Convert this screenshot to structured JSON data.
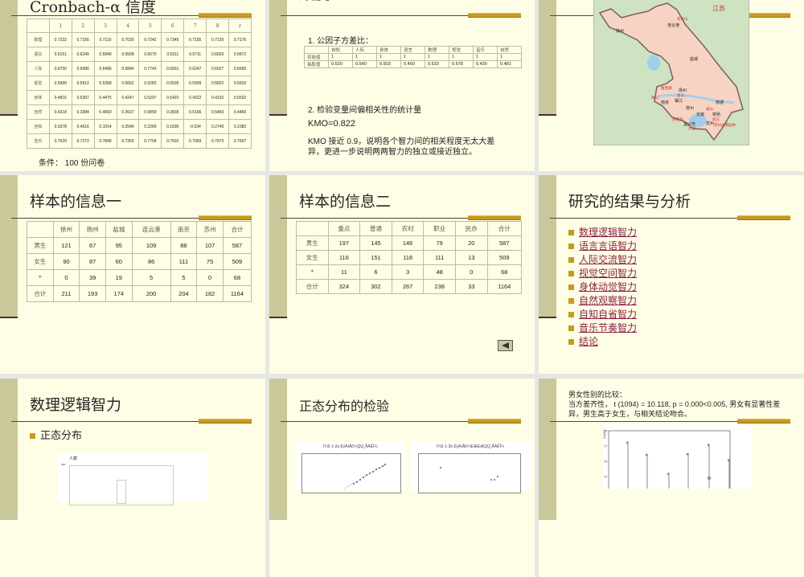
{
  "slide1": {
    "title": "Cronbach-α 信度",
    "footer": "条件： 100 份问卷",
    "table": {
      "headers": [
        "",
        "1",
        "2",
        "3",
        "4",
        "5",
        "6",
        "7",
        "8",
        "r"
      ],
      "rows": [
        [
          "数理",
          "0.7232",
          "0.7156",
          "0.7115",
          "0.7035",
          "0.7242",
          "0.7345",
          "0.7155",
          "0.7130",
          "0.7176"
        ],
        [
          "语言",
          "0.6151",
          "0.6249",
          "0.5949",
          "0.5508",
          "0.6070",
          "0.5311",
          "0.5711",
          "0.6026",
          "0.5872"
        ],
        [
          "人际",
          "0.6750",
          "0.6580",
          "0.6496",
          "0.6846",
          "0.7743",
          "0.6551",
          "0.6247",
          "0.6027",
          "0.6655"
        ],
        [
          "视觉",
          "0.5999",
          "0.5912",
          "0.5358",
          "0.5662",
          "0.6283",
          "0.5535",
          "0.5909",
          "0.5822",
          "0.5810"
        ],
        [
          "身体",
          "0.4816",
          "0.5367",
          "0.4475",
          "0.4247",
          "0.5297",
          "0.5422",
          "0.4322",
          "0.4315",
          "0.5532"
        ],
        [
          "自然",
          "0.4318",
          "0.3384",
          "0.4060",
          "0.3637",
          "0.5859",
          "0.3835",
          "0.5166",
          "0.5460",
          "0.4465"
        ],
        [
          "自知",
          "0.3378",
          "0.4616",
          "0.1014",
          "0.3546",
          "0.2260",
          "0.1830",
          "-0.034",
          "0.2749",
          "0.2382"
        ],
        [
          "音乐",
          "0.7629",
          "0.7272",
          "0.7849",
          "0.7355",
          "0.7704",
          "0.7592",
          "0.7959",
          "0.7973",
          "0.7667"
        ]
      ]
    }
  },
  "slide2": {
    "title": "效度",
    "heading1": "1. 公因子方差比：",
    "table": {
      "headers": [
        "",
        "自知",
        "人际",
        "身体",
        "语言",
        "数理",
        "视觉",
        "音乐",
        "自然"
      ],
      "rows": [
        [
          "初始值",
          "1",
          "1",
          "1",
          "1",
          "1",
          "1",
          "1",
          "1"
        ],
        [
          "抽取值",
          "0.520",
          "0.540",
          "0.503",
          "0.460",
          "0.633",
          "0.578",
          "0.430",
          "0.481"
        ]
      ]
    },
    "heading2": "2. 检验变量间偏相关性的统计量",
    "kmo": "KMO=0.822",
    "para1": "KMO 接近 0.9，说明各个智力间的相关程度无太大差",
    "para2": "异，更进一步说明两两智力的独立或接近独立。"
  },
  "slide3": {
    "map": {
      "province": "江苏",
      "cities": [
        "徐州",
        "连云港",
        "盐城",
        "扬州",
        "南京",
        "镇江",
        "常州",
        "无锡",
        "常熟",
        "南通",
        "苏州",
        "宜兴市"
      ],
      "sights": [
        "花果山",
        "瘦西湖",
        "钟山",
        "金山",
        "虞山",
        "善卷洞",
        "太湖",
        "周庄",
        "苏州古典园林"
      ]
    },
    "colors": {
      "land": "#f7d3c4",
      "sea": "#cfe2c2",
      "water": "#9fd0e8"
    }
  },
  "slide4": {
    "title": "样本的信息一",
    "table": {
      "headers": [
        "",
        "徐州",
        "扬州",
        "盐城",
        "连云港",
        "南京",
        "苏州",
        "合计"
      ],
      "rows": [
        [
          "男生",
          "121",
          "67",
          "95",
          "109",
          "88",
          "107",
          "587"
        ],
        [
          "女生",
          "90",
          "87",
          "60",
          "86",
          "111",
          "75",
          "509"
        ],
        [
          "*",
          "0",
          "39",
          "19",
          "5",
          "5",
          "0",
          "68"
        ],
        [
          "合计",
          "211",
          "193",
          "174",
          "200",
          "204",
          "182",
          "1164"
        ]
      ]
    }
  },
  "slide5": {
    "title": "样本的信息二",
    "table": {
      "headers": [
        "",
        "重点",
        "普通",
        "农村",
        "职业",
        "民办",
        "合计"
      ],
      "rows": [
        [
          "男生",
          "197",
          "145",
          "146",
          "79",
          "20",
          "587"
        ],
        [
          "女生",
          "116",
          "151",
          "118",
          "111",
          "13",
          "509"
        ],
        [
          "*",
          "11",
          "6",
          "3",
          "48",
          "0",
          "68"
        ],
        [
          "合计",
          "324",
          "302",
          "267",
          "238",
          "33",
          "1164"
        ]
      ]
    },
    "back_icon": "triangle-left-icon"
  },
  "slide6": {
    "title": "研究的结果与分析",
    "items": [
      "数理逻辑智力",
      "语言言语智力",
      "人际交流智力",
      "视觉空间智力",
      "身体动觉智力",
      "自然观察智力",
      "自知自省智力",
      "音乐节奏智力",
      "结论"
    ]
  },
  "slide7": {
    "title": "数理逻辑智力",
    "bullet": "正态分布",
    "chart": {
      "ylabel": "人数",
      "tick": "300"
    }
  },
  "slide8": {
    "title": "正态分布的检验",
    "chart_a_title": "Í¼5-1-2a ÉýÀíÂß¼­QQ¸ÃÀÊÍ¼",
    "chart_b_title": "Í¼5-1-2b ÉýÀíÂß¼­ÈÆÉÆQQ¸ÃÀÊÍ¼"
  },
  "slide9": {
    "line1": "男女性别的比较：",
    "line2": "当方差齐性， t (1094) = 10.118,  p = 0.000<0.005,  男女有显著性差",
    "line3": "异，男生高于女生，与相关结论吻合。",
    "chart": {
      "ylabel": "Q-plot",
      "ticks": [
        "18",
        "17",
        "16",
        "15"
      ],
      "upper": [
        17.15,
        16.35,
        15.1,
        16.4,
        17.0,
        16.0
      ],
      "lower": [
        14.9
      ]
    }
  },
  "colors": {
    "slide_bg": "#fefee6",
    "sidebar": "#c9c89b",
    "accent": "#c79a1f",
    "link": "#8a2045"
  }
}
